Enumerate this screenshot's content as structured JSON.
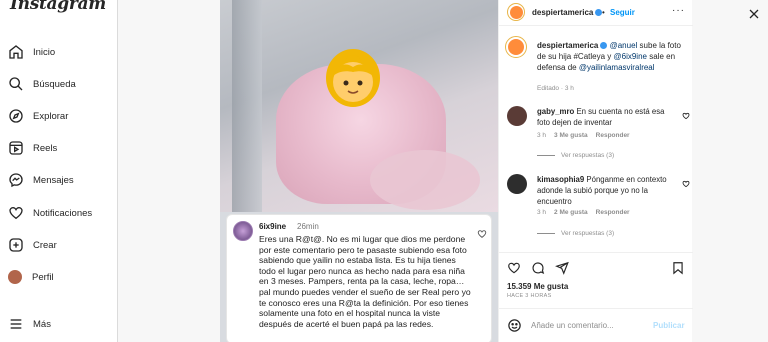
{
  "app": {
    "logo": "Instagram"
  },
  "sidebar": {
    "items": [
      {
        "label": "Inicio",
        "icon": "home-icon"
      },
      {
        "label": "Búsqueda",
        "icon": "search-icon"
      },
      {
        "label": "Explorar",
        "icon": "compass-icon"
      },
      {
        "label": "Reels",
        "icon": "reels-icon"
      },
      {
        "label": "Mensajes",
        "icon": "messenger-icon"
      },
      {
        "label": "Notificaciones",
        "icon": "heart-icon"
      },
      {
        "label": "Crear",
        "icon": "plus-square-icon"
      },
      {
        "label": "Perfil",
        "icon": "avatar"
      },
      {
        "label": "Más",
        "icon": "menu-icon"
      }
    ]
  },
  "embed": {
    "username": "6ix9ine",
    "time": "26min",
    "text": "Eres una R@t@. No es mi lugar que dios me perdone por este comentario pero te pasaste subiendo esa foto sabiendo que yailin no estaba lista. Es tu hija tienes todo el lugar pero nunca as hecho nada para esa niña en 3 meses. Pampers, renta pa la casa, leche, ropa… pal mundo puedes vender el sueño de ser Real pero yo te conosco eres una R@ta la definición. Por eso tienes solamente una foto en el hospital nunca la viste después de acerté el buen papá pa las redes."
  },
  "panel": {
    "header": {
      "username": "despiertamerica",
      "dot": "•",
      "follow": "Seguir",
      "more": "···"
    },
    "caption": {
      "username": "despiertamerica",
      "mention1": "@anuel",
      "text1": "sube la foto de su hija #Catleya y",
      "mention2": "@6ix9ine",
      "text2": "sale en defensa de",
      "mention3": "@yailinlamasviralreal",
      "edited": "Editado · 3 h"
    },
    "comments": [
      {
        "username": "gaby_mro",
        "text": "En su cuenta no está esa foto dejen de inventar",
        "time": "3 h",
        "likes": "3 Me gusta",
        "reply": "Responder",
        "replies": "Ver respuestas (3)",
        "avatar_color": "#5a3b36"
      },
      {
        "username": "kimasophia9",
        "text": "Pónganme en contexto adonde la subió porque yo no la encuentro",
        "time": "3 h",
        "likes": "2 Me gusta",
        "reply": "Responder",
        "replies": "Ver respuestas (3)",
        "avatar_color": "#2d2d2d"
      }
    ],
    "actions": {
      "likes": "15.359 Me gusta",
      "ago": "HACE 3 HORAS",
      "comment_placeholder": "Añade un comentario...",
      "publish": "Publicar"
    }
  },
  "colors": {
    "accent": "#0095f6",
    "link": "#00376b",
    "muted": "#8e8e8e",
    "verified": "#3897f0"
  }
}
